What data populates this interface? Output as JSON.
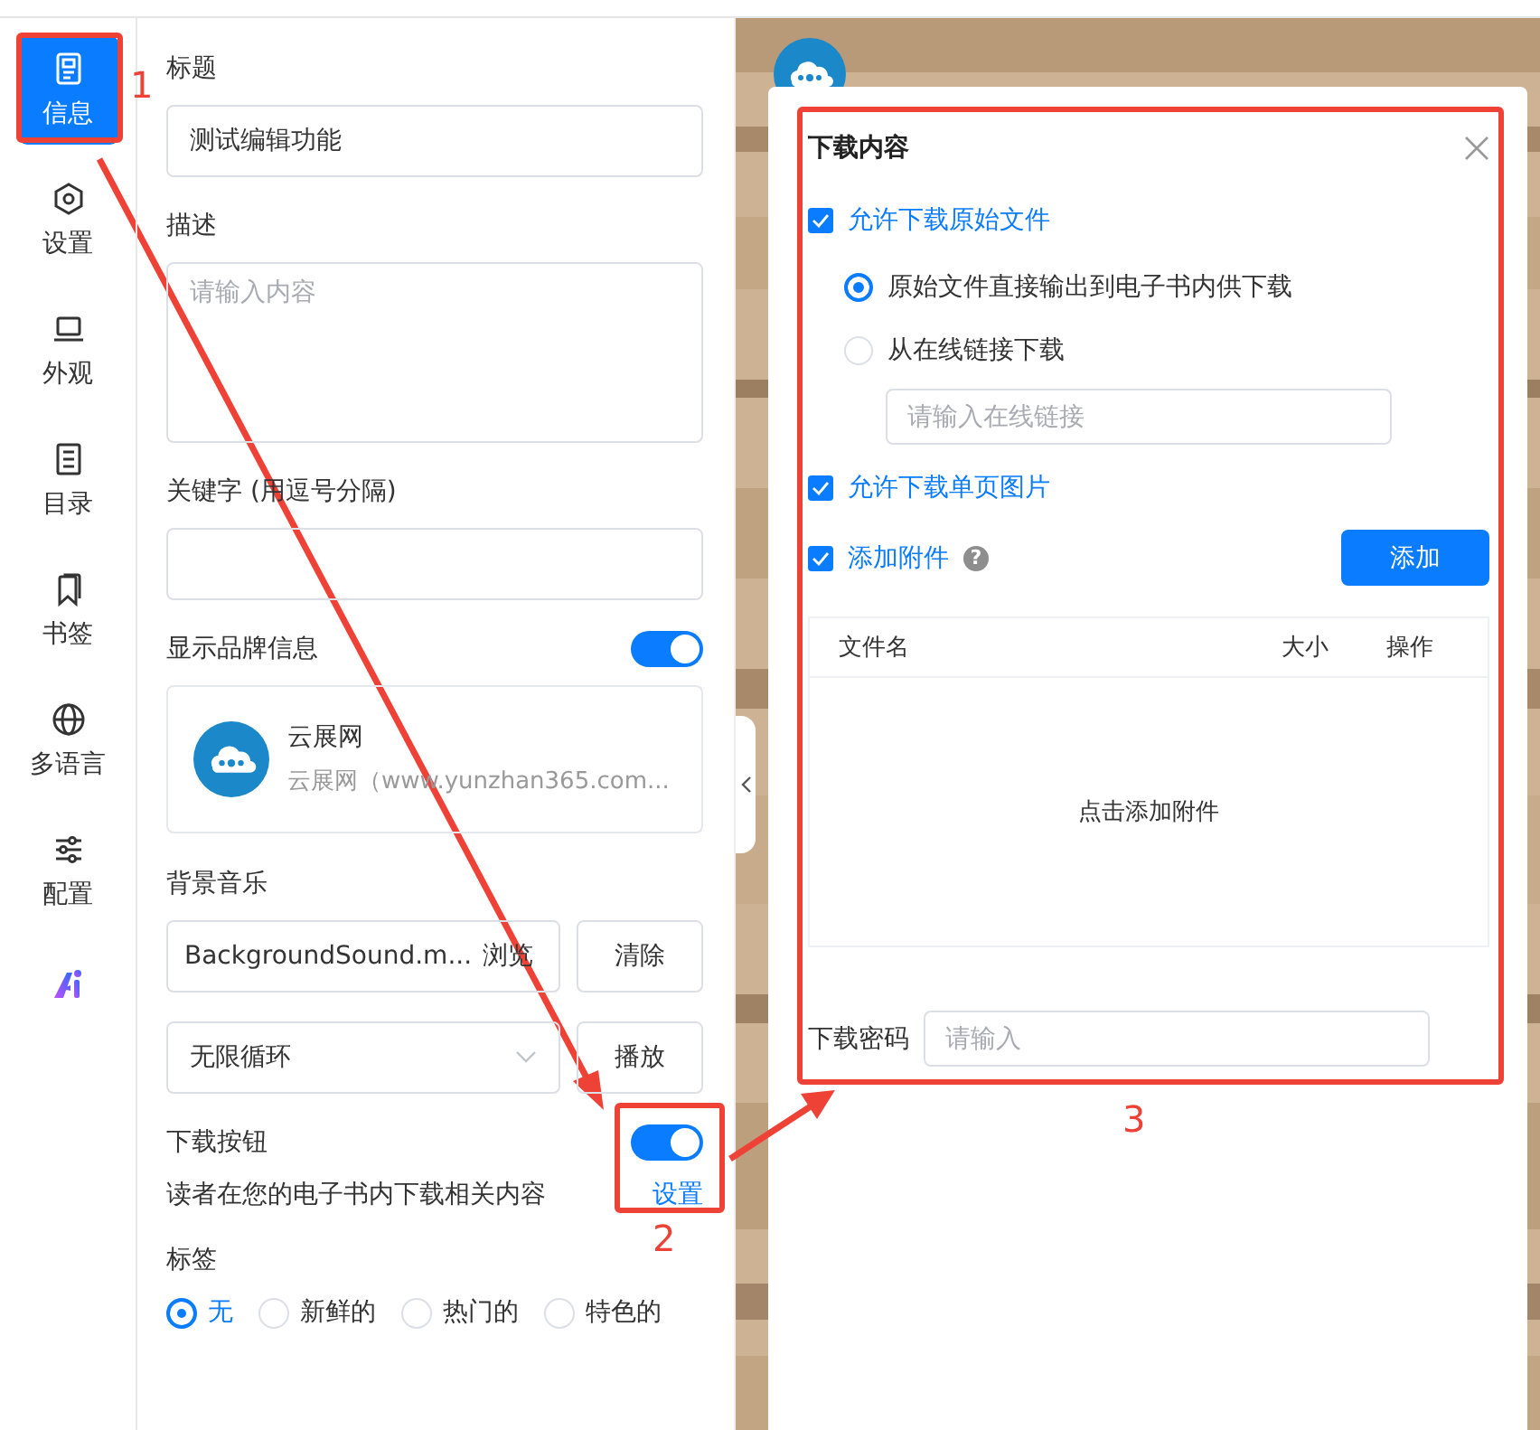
{
  "nav": {
    "items": [
      {
        "label": "信息",
        "selected": true
      },
      {
        "label": "设置",
        "selected": false
      },
      {
        "label": "外观",
        "selected": false
      },
      {
        "label": "目录",
        "selected": false
      },
      {
        "label": "书签",
        "selected": false
      },
      {
        "label": "多语言",
        "selected": false
      },
      {
        "label": "配置",
        "selected": false
      }
    ]
  },
  "form": {
    "title": {
      "label": "标题",
      "value": "测试编辑功能"
    },
    "description": {
      "label": "描述",
      "placeholder": "请输入内容"
    },
    "keywords": {
      "label": "关键字 (用逗号分隔)"
    },
    "brand": {
      "label": "显示品牌信息",
      "on": true,
      "name": "云展网",
      "subtitle": "云展网（www.yunzhan365.com..."
    },
    "music": {
      "label": "背景音乐",
      "file": "BackgroundSound.m...",
      "browse": "浏览",
      "clear": "清除",
      "loop": "无限循环",
      "play": "播放"
    },
    "download": {
      "label": "下载按钮",
      "on": true,
      "description": "读者在您的电子书内下载相关内容",
      "settings": "设置"
    },
    "tags": {
      "label": "标签",
      "options": [
        {
          "label": "无",
          "selected": true
        },
        {
          "label": "新鲜的",
          "selected": false
        },
        {
          "label": "热门的",
          "selected": false
        },
        {
          "label": "特色的",
          "selected": false
        }
      ]
    }
  },
  "dialog": {
    "title": "下载内容",
    "original": {
      "label": "允许下载原始文件",
      "checked": true,
      "modes": [
        {
          "label": "原始文件直接输出到电子书内供下载",
          "selected": true
        },
        {
          "label": "从在线链接下载",
          "selected": false
        }
      ],
      "link_placeholder": "请输入在线链接"
    },
    "pages": {
      "label": "允许下载单页图片",
      "checked": true
    },
    "attachments": {
      "label": "添加附件",
      "checked": true,
      "help": "?",
      "add": "添加",
      "columns": [
        "文件名",
        "大小",
        "操作"
      ],
      "empty": "点击添加附件"
    },
    "password": {
      "label": "下载密码",
      "placeholder": "请输入"
    }
  },
  "annotations": [
    {
      "label": "1"
    },
    {
      "label": "2"
    },
    {
      "label": "3"
    }
  ]
}
